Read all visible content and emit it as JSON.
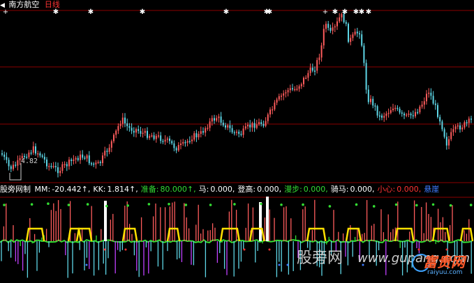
{
  "header": {
    "stock_name": "南方航空",
    "period": "日线"
  },
  "price": {
    "low_label": "4.82"
  },
  "indicator": {
    "name": "股旁网制",
    "items": [
      {
        "label": "MM:",
        "value": "-20.442↑,",
        "color": "#ffffff"
      },
      {
        "label": "KK:",
        "value": "1.814↑,",
        "color": "#ffffff"
      },
      {
        "label": "准备:",
        "value": "80.000↑,",
        "color": "#33dd33"
      },
      {
        "label": "马:",
        "value": "0.000,",
        "color": "#ffffff"
      },
      {
        "label": "登高:",
        "value": "0.000,",
        "color": "#ffffff"
      },
      {
        "label": "漫步:",
        "value": "0.000,",
        "color": "#33dd33"
      },
      {
        "label": "骑马:",
        "value": "0.000,",
        "color": "#ffffff"
      },
      {
        "label": "小心:",
        "value": "0.000,",
        "color": "#ff3333"
      },
      {
        "label": "悬崖",
        "value": "",
        "color": "#3f7cff"
      }
    ]
  },
  "watermark": {
    "text1": "股旁网",
    "text2": "www.gupang.com",
    "logo_big": "富贵网",
    "logo_small": "raiyuu.com"
  },
  "colors": {
    "up": "#ff5c5c",
    "down": "#5ed6e6",
    "grid": "#8b0000",
    "green": "#33dd33",
    "yellow": "#ffe000",
    "magenta": "#c040ff"
  }
}
